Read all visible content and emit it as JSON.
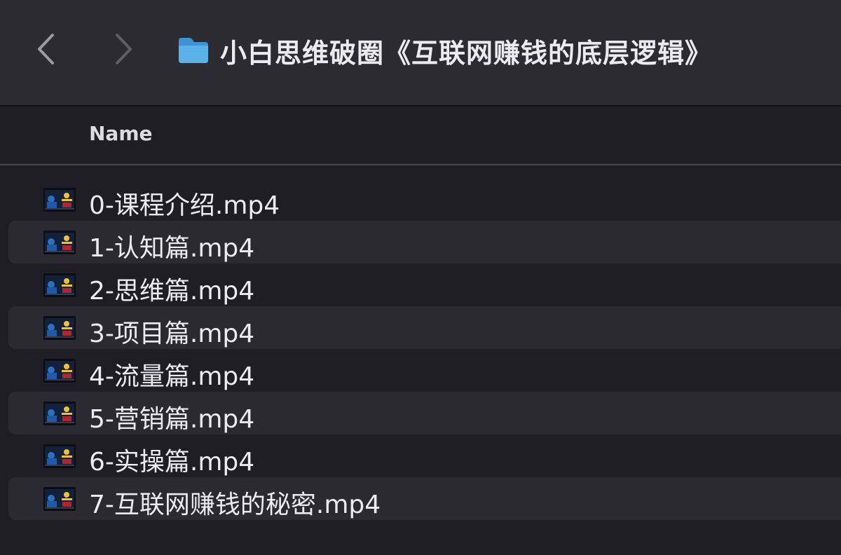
{
  "toolbar": {
    "back_icon": "chevron-left-icon",
    "forward_icon": "chevron-right-icon",
    "folder_icon": "folder-icon",
    "title": "小白思维破圈《互联网赚钱的底层逻辑》",
    "folder_color": "#5ab2e8"
  },
  "list": {
    "column_name": "Name",
    "files": [
      {
        "name": "0-课程介绍.mp4",
        "icon": "video-thumbnail-icon"
      },
      {
        "name": "1-认知篇.mp4",
        "icon": "video-thumbnail-icon"
      },
      {
        "name": "2-思维篇.mp4",
        "icon": "video-thumbnail-icon"
      },
      {
        "name": "3-项目篇.mp4",
        "icon": "video-thumbnail-icon"
      },
      {
        "name": "4-流量篇.mp4",
        "icon": "video-thumbnail-icon"
      },
      {
        "name": "5-营销篇.mp4",
        "icon": "video-thumbnail-icon"
      },
      {
        "name": "6-实操篇.mp4",
        "icon": "video-thumbnail-icon"
      },
      {
        "name": "7-互联网赚钱的秘密.mp4",
        "icon": "video-thumbnail-icon"
      }
    ]
  },
  "colors": {
    "background": "#1f1e25",
    "toolbar": "#2c2b31",
    "row_stripe": "#2b2a31",
    "text": "#ececef"
  }
}
